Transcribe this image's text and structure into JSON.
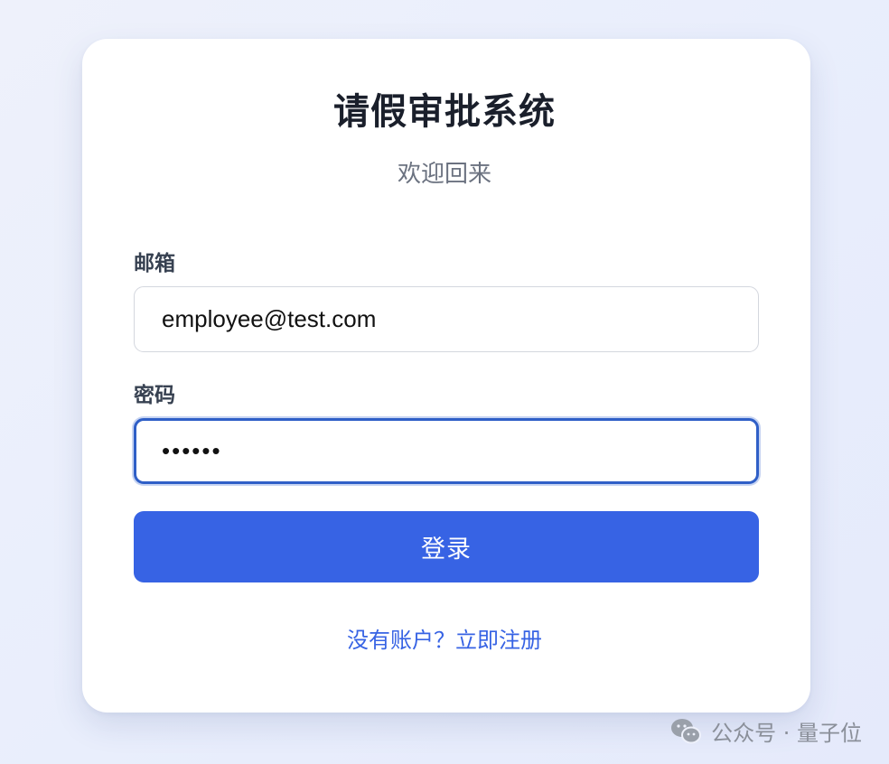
{
  "app": {
    "title": "请假审批系统",
    "subtitle": "欢迎回来"
  },
  "form": {
    "email_label": "邮箱",
    "email_value": "employee@test.com",
    "password_label": "密码",
    "password_value": "••••••",
    "submit_label": "登录",
    "register_link": "没有账户？立即注册"
  },
  "watermark": {
    "icon": "wechat-icon",
    "text": "公众号 · 量子位"
  },
  "colors": {
    "accent": "#3763e4",
    "focus_border": "#2f5fc7"
  }
}
